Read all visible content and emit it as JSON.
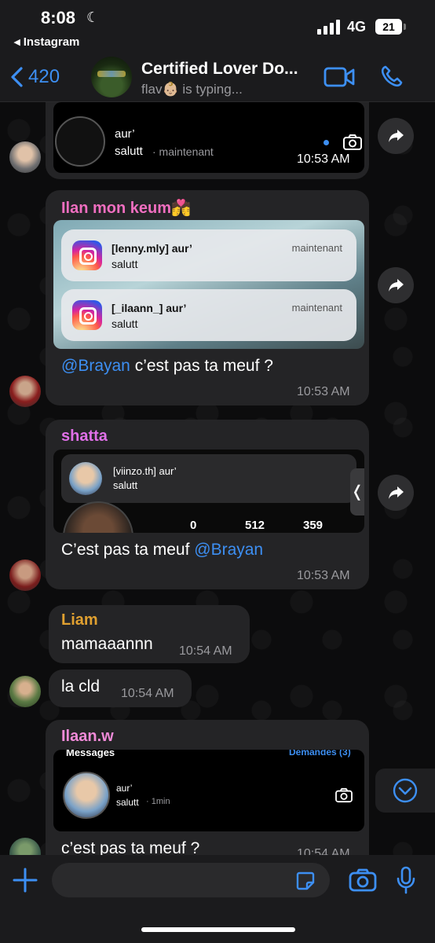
{
  "status_bar": {
    "time": "8:08",
    "back_app": "◂ Instagram",
    "network": "4G",
    "battery": "21"
  },
  "header": {
    "back_count": "420",
    "title": "Certified Lover Do...",
    "subtitle": "flav👶🏼 is typing..."
  },
  "messages": [
    {
      "id": "m1",
      "shot": {
        "label": "aur’",
        "sub": "salutt",
        "sub_time": "· maintenant"
      },
      "time": "10:53 AM"
    },
    {
      "id": "m2",
      "sender": "Ilan mon keum💏",
      "sender_color": "#f06ec0",
      "notifications": [
        {
          "title": "[lenny.mly] aur’",
          "body": "salutt",
          "time": "maintenant"
        },
        {
          "title": "[_ilaann_] aur’",
          "body": "salutt",
          "time": "maintenant"
        }
      ],
      "mention": "@Brayan",
      "text": " c’est pas ta meuf ?",
      "time": "10:53 AM"
    },
    {
      "id": "m3",
      "sender": "shatta",
      "sender_color": "#e070e8",
      "shot": {
        "label": "[viinzo.th] aur’",
        "sub": "salutt",
        "stats": [
          "0",
          "512",
          "359"
        ]
      },
      "text": "C’est pas ta meuf ",
      "mention": "@Brayan",
      "time": "10:53 AM"
    },
    {
      "id": "m4",
      "sender": "Liam",
      "sender_color": "#e0a030",
      "text": "mamaaannn",
      "time": "10:54 AM"
    },
    {
      "id": "m5",
      "text": "la cld",
      "time": "10:54 AM"
    },
    {
      "id": "m6",
      "sender": "Ilaan.w",
      "sender_color": "#f08ad8",
      "shot": {
        "header_left": "Messages",
        "header_right": "Demandes (3)",
        "label": "aur’",
        "sub": "salutt",
        "sub_time": "· 1min"
      },
      "text": "c’est pas ta meuf ?",
      "time": "10:54 AM"
    }
  ],
  "colors": {
    "accent": "#3d8ff3",
    "bubble": "#242426",
    "bar": "#1b1b1d"
  }
}
